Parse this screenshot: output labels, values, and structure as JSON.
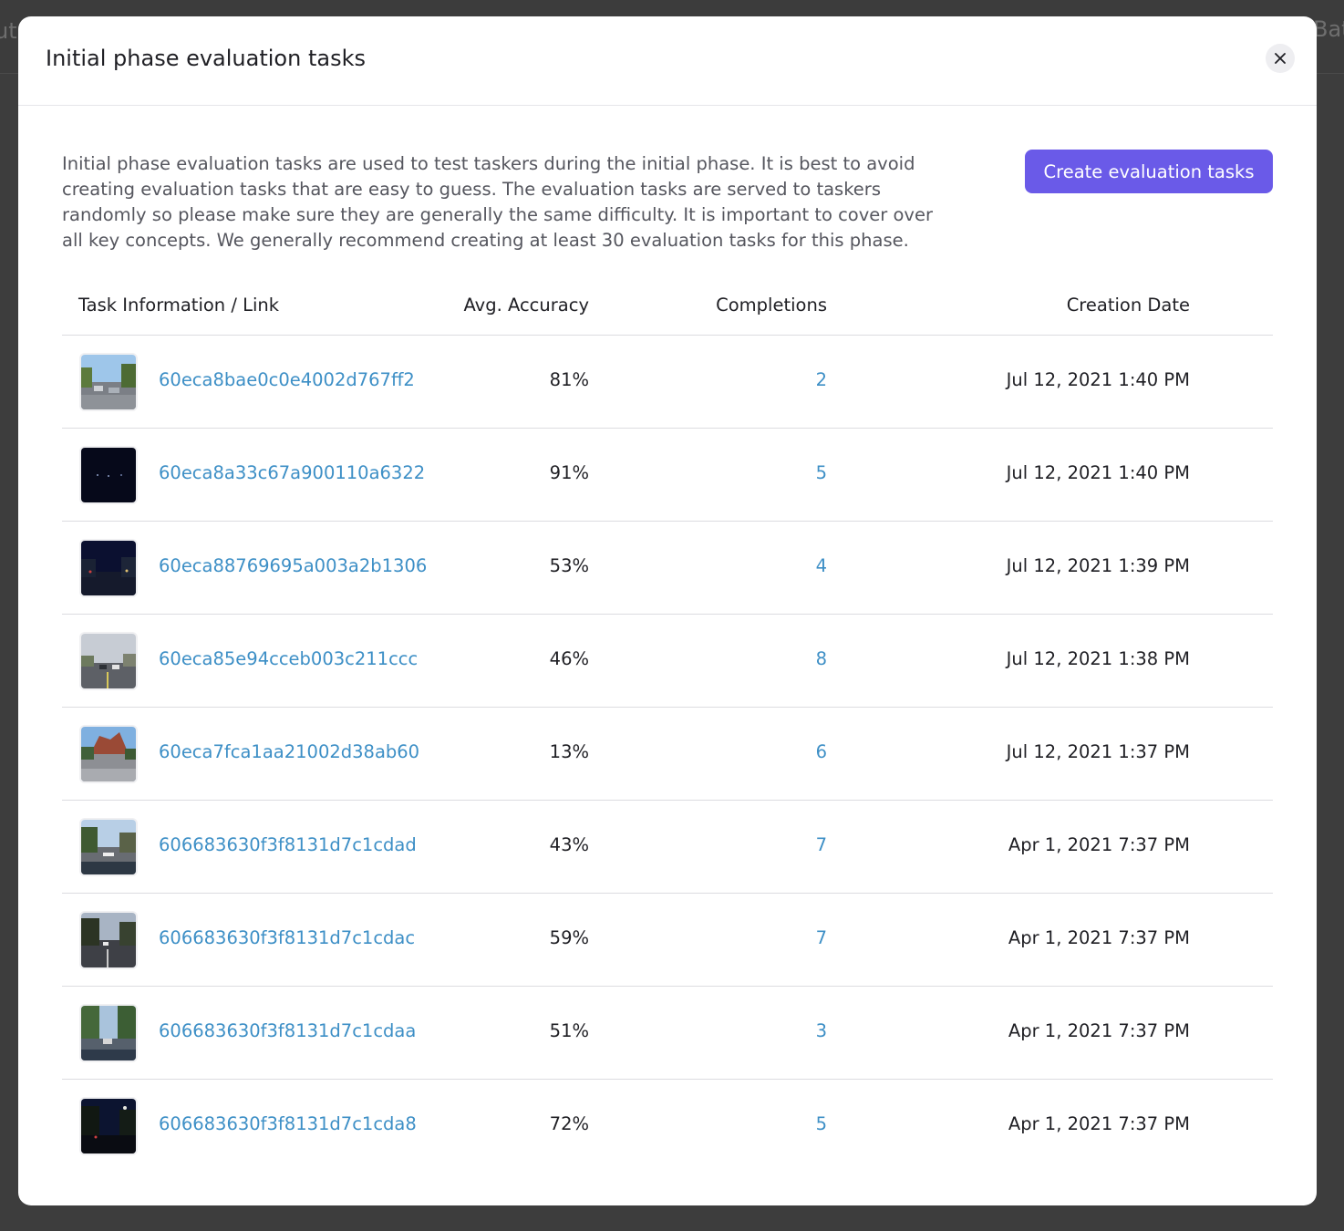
{
  "background": {
    "left_text": "ut",
    "right_text": "Bat"
  },
  "modal": {
    "title": "Initial phase evaluation tasks",
    "close_icon": "close-icon",
    "description": "Initial phase evaluation tasks are used to test taskers during the initial phase. It is best to avoid creating evaluation tasks that are easy to guess. The evaluation tasks are served to taskers randomly so please make sure they are generally the same difficulty. It is important to cover over all key concepts. We generally recommend creating at least 30 evaluation tasks for this phase.",
    "create_button": "Create evaluation tasks"
  },
  "table": {
    "headers": {
      "task": "Task Information / Link",
      "accuracy": "Avg. Accuracy",
      "completions": "Completions",
      "date": "Creation Date"
    },
    "rows": [
      {
        "id": "60eca8bae0c0e4002d767ff2",
        "accuracy": "81%",
        "completions": "2",
        "date": "Jul 12, 2021 1:40 PM",
        "thumb": "day-street"
      },
      {
        "id": "60eca8a33c67a900110a6322",
        "accuracy": "91%",
        "completions": "5",
        "date": "Jul 12, 2021 1:40 PM",
        "thumb": "night-dark"
      },
      {
        "id": "60eca88769695a003a2b1306",
        "accuracy": "53%",
        "completions": "4",
        "date": "Jul 12, 2021 1:39 PM",
        "thumb": "night-street"
      },
      {
        "id": "60eca85e94cceb003c211ccc",
        "accuracy": "46%",
        "completions": "8",
        "date": "Jul 12, 2021 1:38 PM",
        "thumb": "overcast-road"
      },
      {
        "id": "60eca7fca1aa21002d38ab60",
        "accuracy": "13%",
        "completions": "6",
        "date": "Jul 12, 2021 1:37 PM",
        "thumb": "rocky-road"
      },
      {
        "id": "606683630f3f8131d7c1cdad",
        "accuracy": "43%",
        "completions": "7",
        "date": "Apr 1, 2021 7:37 PM",
        "thumb": "suburb-day"
      },
      {
        "id": "606683630f3f8131d7c1cdac",
        "accuracy": "59%",
        "completions": "7",
        "date": "Apr 1, 2021 7:37 PM",
        "thumb": "dusk-road"
      },
      {
        "id": "606683630f3f8131d7c1cdaa",
        "accuracy": "51%",
        "completions": "3",
        "date": "Apr 1, 2021 7:37 PM",
        "thumb": "tree-street"
      },
      {
        "id": "606683630f3f8131d7c1cda8",
        "accuracy": "72%",
        "completions": "5",
        "date": "Apr 1, 2021 7:37 PM",
        "thumb": "night-trees"
      }
    ]
  },
  "colors": {
    "accent": "#6a5ae8",
    "link": "#3d8fc6",
    "backdrop": "#3a3a3a"
  }
}
